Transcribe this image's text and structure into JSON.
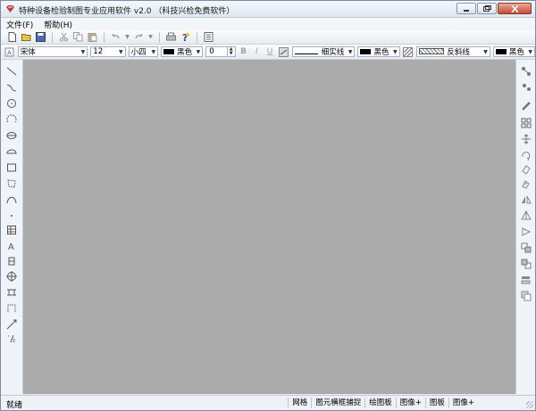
{
  "window": {
    "title": "特种设备检验制图专业应用软件 v2.0 （科技兴检免费软件）"
  },
  "menu": {
    "items": [
      "文件(F)",
      "帮助(H)"
    ]
  },
  "format_toolbar": {
    "font_name": "宋体",
    "font_size": "12",
    "font_size_name": "小四",
    "text_color": "黑色",
    "spin_value": "0",
    "bold": "B",
    "italic": "I",
    "underline": "U",
    "line_style": "细实线",
    "line_color": "黑色",
    "hatch_style": "反斜线",
    "hatch_color": "黑色"
  },
  "status": {
    "left_text": "就绪",
    "cells": [
      "网格",
      "图元横框捕捉",
      "绘图板",
      "图像+",
      "图板",
      "图像+"
    ]
  },
  "colors": {
    "canvas": "#ababab",
    "chrome": "#e9edf2",
    "close_button": "#c74a35"
  }
}
